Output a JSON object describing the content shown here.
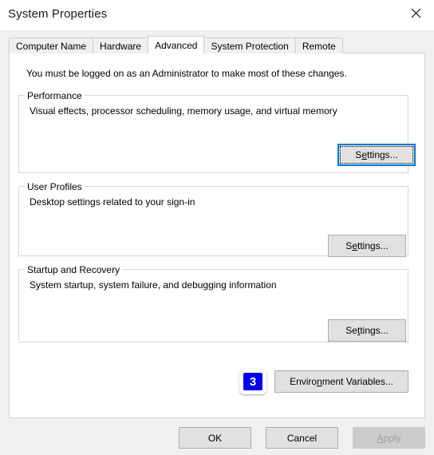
{
  "window": {
    "title": "System Properties",
    "close_icon": "close-icon"
  },
  "tabs": [
    {
      "label": "Computer Name",
      "selected": false
    },
    {
      "label": "Hardware",
      "selected": false
    },
    {
      "label": "Advanced",
      "selected": true
    },
    {
      "label": "System Protection",
      "selected": false
    },
    {
      "label": "Remote",
      "selected": false
    }
  ],
  "main": {
    "admin_note": "You must be logged on as an Administrator to make most of these changes.",
    "groups": [
      {
        "legend": "Performance",
        "description": "Visual effects, processor scheduling, memory usage, and virtual memory",
        "button": {
          "label": "Settings...",
          "accel_before": "S",
          "accel": "e",
          "accel_after": "ttings...",
          "focused": true
        }
      },
      {
        "legend": "User Profiles",
        "description": "Desktop settings related to your sign-in",
        "button": {
          "label": "Settings...",
          "accel_before": "S",
          "accel": "e",
          "accel_after": "ttings...",
          "focused": false
        }
      },
      {
        "legend": "Startup and Recovery",
        "description": "System startup, system failure, and debugging information",
        "button": {
          "label": "Settings...",
          "accel_before": "Se",
          "accel": "t",
          "accel_after": "tings...",
          "focused": false
        }
      }
    ],
    "environment_variables_button": {
      "label": "Environment Variables...",
      "accel_before": "Enviro",
      "accel": "n",
      "accel_after": "ment Variables..."
    },
    "annotation_badge": {
      "number": "3",
      "color": "#0000ee",
      "text_color": "#ffffff"
    }
  },
  "footer": {
    "ok": "OK",
    "cancel": "Cancel",
    "apply_before": "",
    "apply_accel": "A",
    "apply_after": "pply",
    "apply_disabled": true
  }
}
